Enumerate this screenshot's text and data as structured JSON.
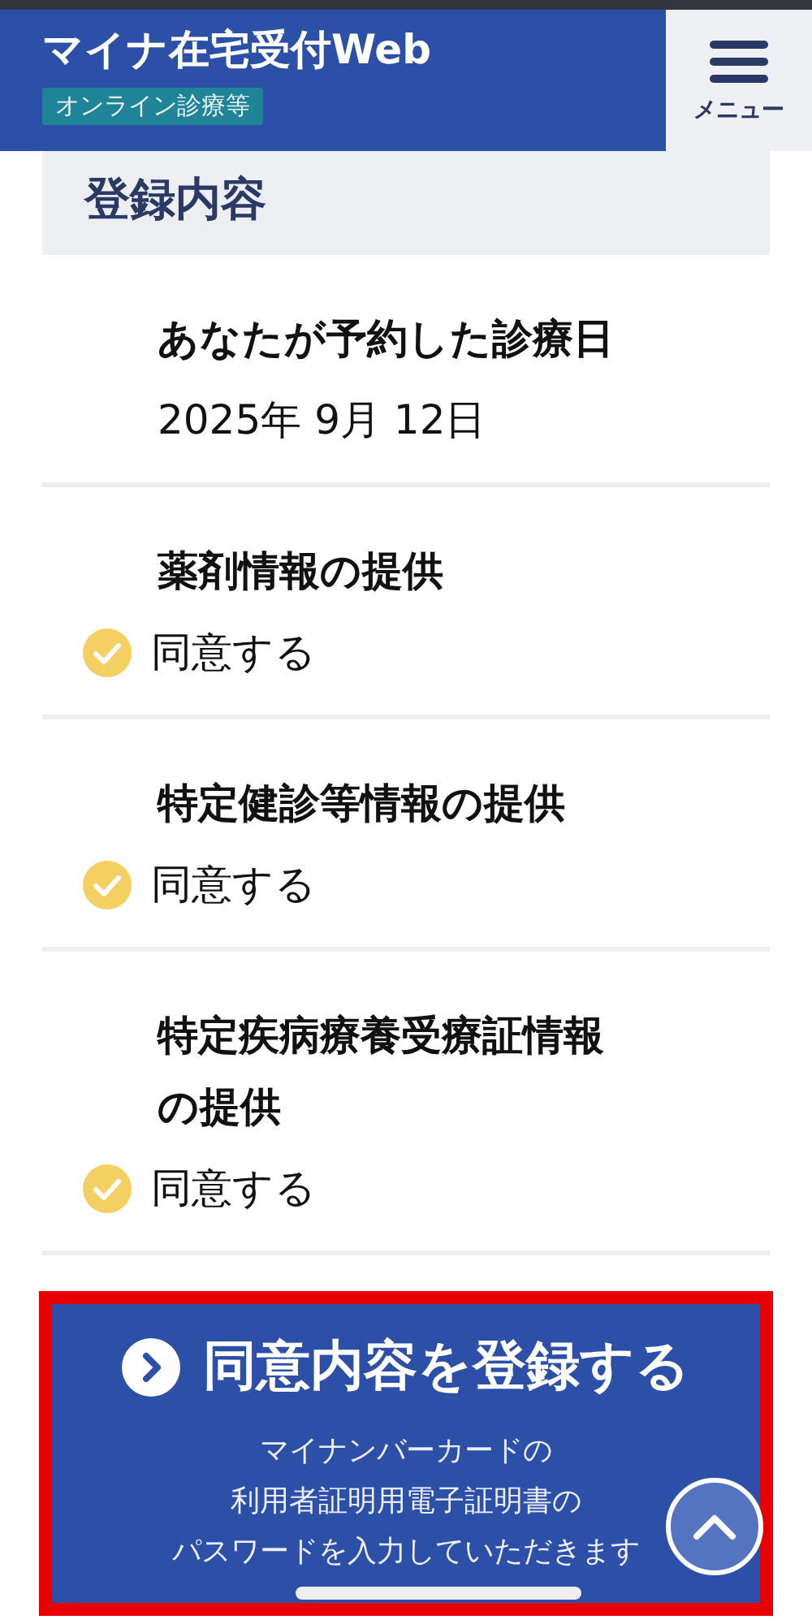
{
  "header": {
    "title": "マイナ在宅受付Web",
    "badge": "オンライン診療等",
    "menu_label": "メニュー"
  },
  "section_title": "登録内容",
  "items": [
    {
      "kind": "date",
      "label": "あなたが予約した診療日",
      "value": "2025年 9月 12日"
    },
    {
      "kind": "consent",
      "label": "薬剤情報の提供",
      "value": "同意する",
      "checked": true
    },
    {
      "kind": "consent",
      "label": "特定健診等情報の提供",
      "value": "同意する",
      "checked": true
    },
    {
      "kind": "consent",
      "label": "特定疾病療養受療証情報の提供",
      "value": "同意する",
      "checked": true
    }
  ],
  "submit": {
    "label": "同意内容を登録する",
    "note": [
      "マイナンバーカードの",
      "利用者証明用電子証明書の",
      "パスワードを入力していただきます"
    ],
    "highlighted": true
  }
}
